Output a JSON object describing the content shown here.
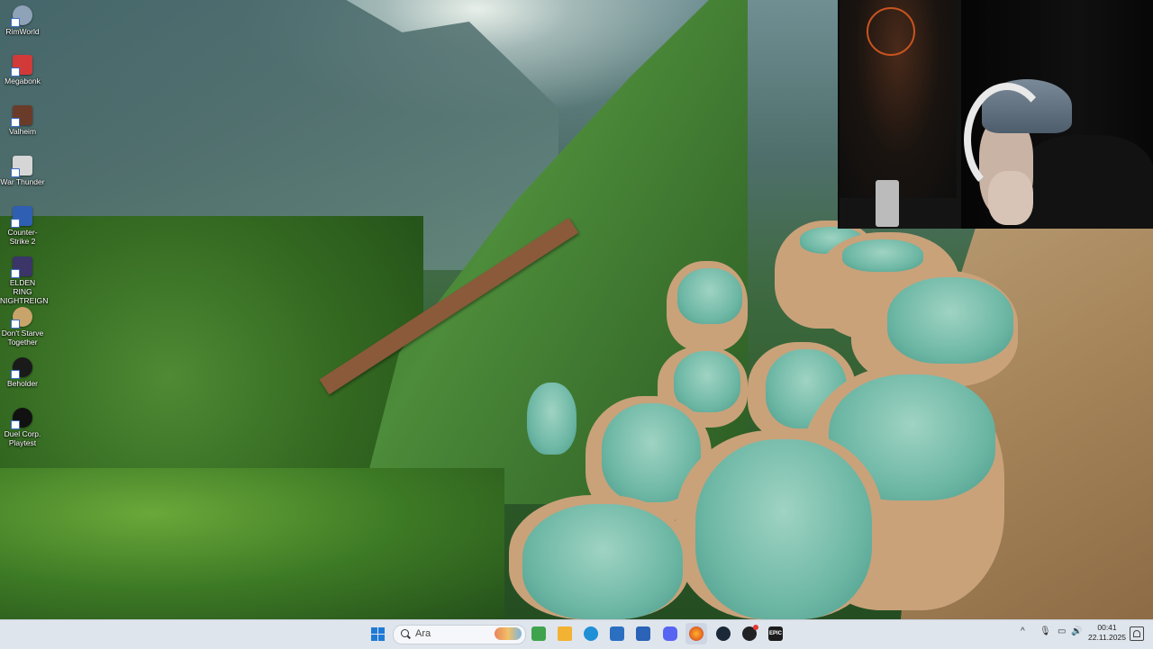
{
  "desktop": {
    "icons": [
      {
        "label": "RimWorld",
        "icon": "rimworld-icon",
        "color": "#8fa3b8"
      },
      {
        "label": "Megabonk",
        "icon": "megabonk-icon",
        "color": "#d23a3a"
      },
      {
        "label": "Valheim",
        "icon": "valheim-icon",
        "color": "#6b3b2a"
      },
      {
        "label": "War Thunder",
        "icon": "war-thunder-icon",
        "color": "#d6d6d6"
      },
      {
        "label": "Counter-Strike 2",
        "icon": "counter-strike-icon",
        "color": "#2f5fb3"
      },
      {
        "label": "ELDEN RING NIGHTREIGN",
        "icon": "elden-ring-icon",
        "color": "#3b3568"
      },
      {
        "label": "Don't Starve Together",
        "icon": "dont-starve-icon",
        "color": "#c9a46a"
      },
      {
        "label": "Beholder",
        "icon": "beholder-icon",
        "color": "#1a1a1a"
      },
      {
        "label": "Duel Corp. Playtest",
        "icon": "duel-corp-icon",
        "color": "#111111"
      }
    ]
  },
  "taskbar": {
    "search_placeholder": "Ara",
    "apps": [
      {
        "name": "start-button",
        "icon": "windows-logo-icon"
      },
      {
        "name": "game-launcher-button",
        "icon": "game-launcher-icon",
        "color": "#3fa34d"
      },
      {
        "name": "file-explorer-button",
        "icon": "folder-icon",
        "color": "#f2b233"
      },
      {
        "name": "edge-button",
        "icon": "edge-icon",
        "color": "#1f8fd6"
      },
      {
        "name": "store-button",
        "icon": "store-icon",
        "color": "#2b6fc1"
      },
      {
        "name": "mail-button",
        "icon": "mail-icon",
        "color": "#2a63b7"
      },
      {
        "name": "discord-button",
        "icon": "discord-icon",
        "color": "#5865f2"
      },
      {
        "name": "firefox-button",
        "icon": "firefox-icon",
        "color": "#e66b1f"
      },
      {
        "name": "steam-button",
        "icon": "steam-icon",
        "color": "#1b2838"
      },
      {
        "name": "obs-button",
        "icon": "obs-icon",
        "color": "#222222"
      },
      {
        "name": "epic-games-button",
        "icon": "epic-games-icon",
        "color": "#1c1c1c"
      }
    ],
    "epic_label": "EPIC",
    "tray": {
      "chevron": "^",
      "mic": "🎙",
      "network": "▭",
      "volume": "🔊",
      "time": "00:41",
      "date": "22.11.2025"
    }
  }
}
